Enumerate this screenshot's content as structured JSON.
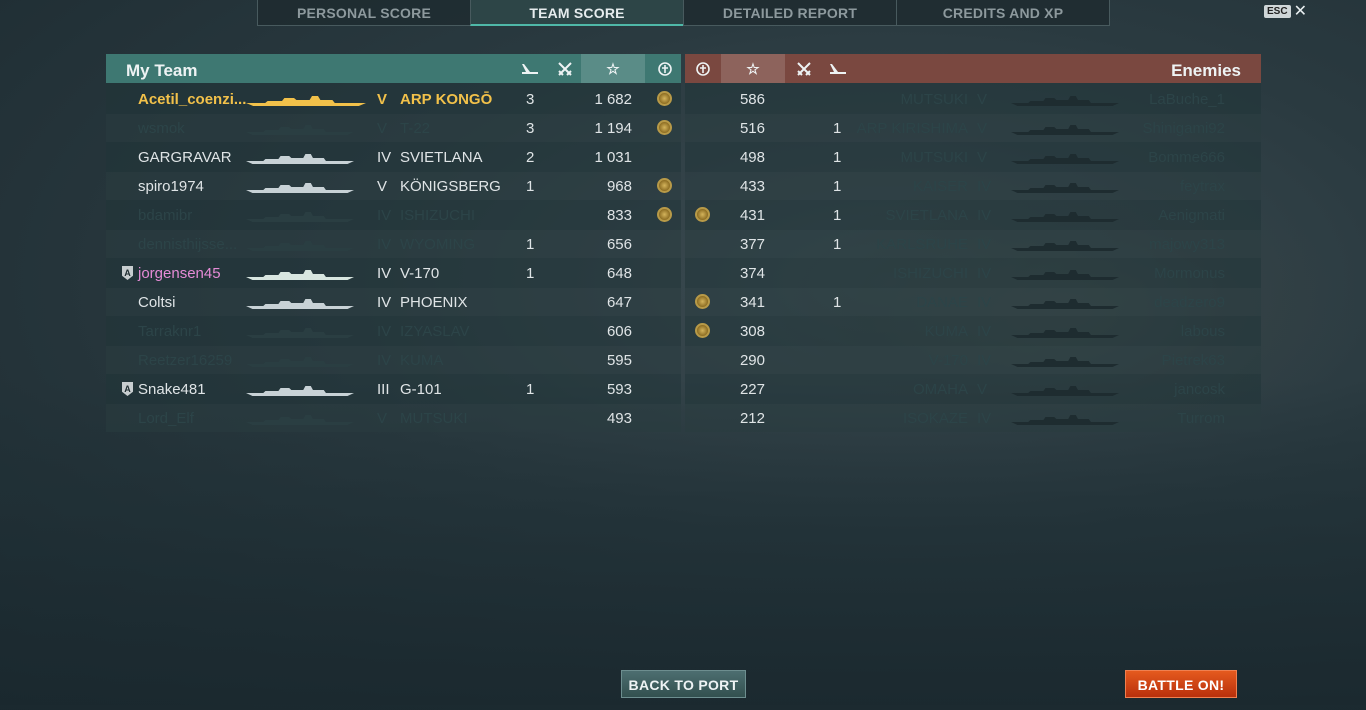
{
  "tabs": [
    {
      "label": "PERSONAL SCORE",
      "active": false
    },
    {
      "label": "TEAM SCORE",
      "active": true
    },
    {
      "label": "DETAILED REPORT",
      "active": false
    },
    {
      "label": "CREDITS AND XP",
      "active": false
    }
  ],
  "esc_key": "ESC",
  "my_team": {
    "title": "My Team",
    "columns": [
      "planes-shot",
      "ships-destroyed",
      "star",
      "captain"
    ],
    "players": [
      {
        "name": "Acetil_coenzi...",
        "tier": "V",
        "ship": "ARP KONGŌ",
        "kills": "3",
        "score": "1 682",
        "medal": true,
        "style": "self"
      },
      {
        "name": "wsmok",
        "tier": "V",
        "ship": "T-22",
        "kills": "3",
        "score": "1 194",
        "medal": true,
        "style": "dead"
      },
      {
        "name": "GARGRAVAR",
        "tier": "IV",
        "ship": "SVIETLANA",
        "kills": "2",
        "score": "1 031",
        "medal": false,
        "style": "alive"
      },
      {
        "name": "spiro1974",
        "tier": "V",
        "ship": "KÖNIGSBERG",
        "kills": "1",
        "score": "968",
        "medal": true,
        "style": "alive"
      },
      {
        "name": "bdamibr",
        "tier": "IV",
        "ship": "ISHIZUCHI",
        "kills": "",
        "score": "833",
        "medal": true,
        "style": "dead"
      },
      {
        "name": "dennisthijsse...",
        "tier": "IV",
        "ship": "WYOMING",
        "kills": "1",
        "score": "656",
        "medal": false,
        "style": "dead"
      },
      {
        "name": "jorgensen45",
        "tier": "IV",
        "ship": "V-170",
        "kills": "1",
        "score": "648",
        "medal": false,
        "style": "division",
        "badge": "A"
      },
      {
        "name": "Coltsi",
        "tier": "IV",
        "ship": "PHOENIX",
        "kills": "",
        "score": "647",
        "medal": false,
        "style": "alive"
      },
      {
        "name": "Tarraknr1",
        "tier": "IV",
        "ship": "IZYASLAV",
        "kills": "",
        "score": "606",
        "medal": false,
        "style": "dead"
      },
      {
        "name": "Reetzer16259",
        "tier": "IV",
        "ship": "KUMA",
        "kills": "",
        "score": "595",
        "medal": false,
        "style": "dead"
      },
      {
        "name": "Snake481",
        "tier": "III",
        "ship": "G-101",
        "kills": "1",
        "score": "593",
        "medal": false,
        "style": "alive",
        "badge": "A"
      },
      {
        "name": "Lord_Elf",
        "tier": "V",
        "ship": "MUTSUKI",
        "kills": "",
        "score": "493",
        "medal": false,
        "style": "dead"
      }
    ]
  },
  "enemies": {
    "title": "Enemies",
    "players": [
      {
        "name": "LaBuche_1",
        "tier": "V",
        "ship": "MUTSUKI",
        "kills": "",
        "score": "586",
        "medal": false
      },
      {
        "name": "Shinigami92",
        "tier": "V",
        "ship": "ARP KIRISHIMA",
        "kills": "1",
        "score": "516",
        "medal": false
      },
      {
        "name": "Bomme666",
        "tier": "V",
        "ship": "MUTSUKI",
        "kills": "1",
        "score": "498",
        "medal": false
      },
      {
        "name": "feytrax",
        "tier": "IV",
        "ship": "KAISER",
        "kills": "1",
        "score": "433",
        "medal": false
      },
      {
        "name": "Aenigmati",
        "tier": "IV",
        "ship": "SVIETLANA",
        "kills": "1",
        "score": "431",
        "medal": true
      },
      {
        "name": "majowy313",
        "tier": "IV",
        "ship": "KARLSRUHE",
        "kills": "1",
        "score": "377",
        "medal": false
      },
      {
        "name": "Mormonus",
        "tier": "IV",
        "ship": "ISHIZUCHI",
        "kills": "",
        "score": "374",
        "medal": false
      },
      {
        "name": "deadzero9",
        "tier": "IV",
        "ship": "DANAE",
        "kills": "1",
        "score": "341",
        "medal": true
      },
      {
        "name": "labous",
        "tier": "IV",
        "ship": "KUMA",
        "kills": "",
        "score": "308",
        "medal": true
      },
      {
        "name": "Pietrek63",
        "tier": "IV",
        "ship": "V-170",
        "kills": "",
        "score": "290",
        "medal": false
      },
      {
        "name": "jancosk",
        "tier": "V",
        "ship": "OMAHA",
        "kills": "",
        "score": "227",
        "medal": false
      },
      {
        "name": "Turrom",
        "tier": "IV",
        "ship": "ISOKAZE",
        "kills": "",
        "score": "212",
        "medal": false
      }
    ]
  },
  "buttons": {
    "back": "BACK TO PORT",
    "battle": "BATTLE ON!"
  },
  "colors": {
    "my_team_header": "#3e7872",
    "enemy_header": "#7a4840",
    "self_gold": "#f2c14a",
    "division_pink": "#e58bd6"
  }
}
